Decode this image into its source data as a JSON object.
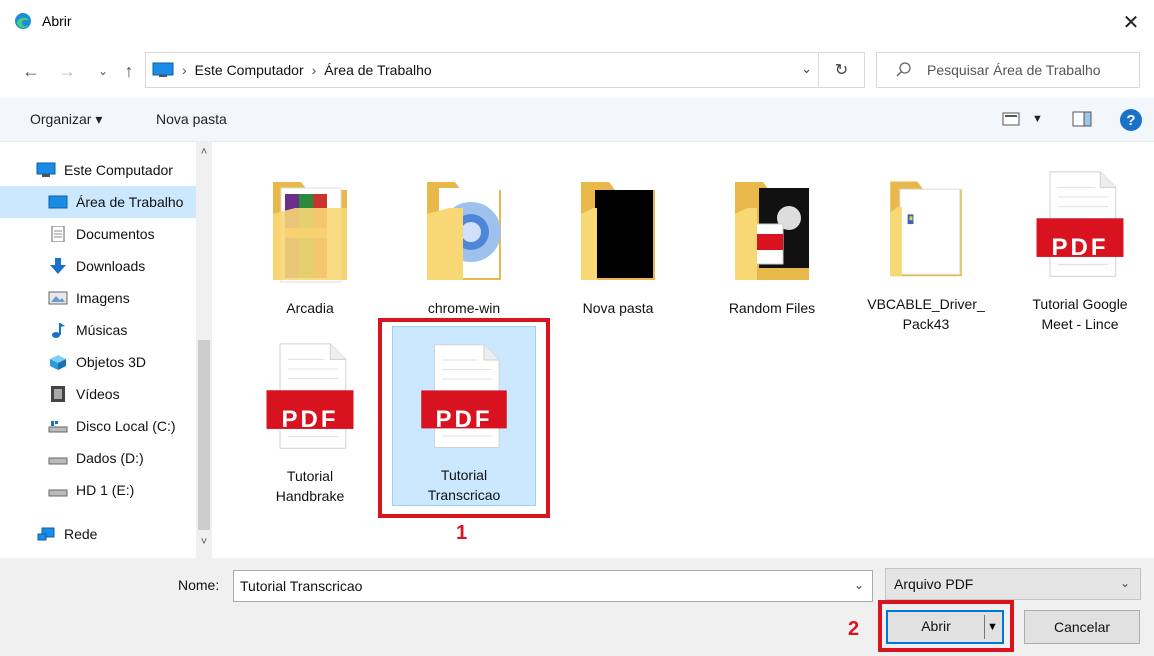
{
  "window": {
    "title": "Abrir",
    "close_glyph": "✕"
  },
  "nav": {
    "back_glyph": "←",
    "forward_glyph": "→",
    "recent_glyph": "⌄",
    "up_glyph": "↑",
    "breadcrumb": [
      "Este Computador",
      "Área de Trabalho"
    ],
    "breadcrumb_sep": "›",
    "dropdown_glyph": "⌄",
    "refresh_glyph": "↻",
    "search_placeholder": "Pesquisar Área de Trabalho"
  },
  "toolbar": {
    "organize_label": "Organizar ▾",
    "new_folder_label": "Nova pasta",
    "help_glyph": "?"
  },
  "sidebar": {
    "items": [
      {
        "label": "Este Computador",
        "icon": "computer-icon"
      },
      {
        "label": "Área de Trabalho",
        "icon": "desktop-icon",
        "selected": true
      },
      {
        "label": "Documentos",
        "icon": "documents-icon"
      },
      {
        "label": "Downloads",
        "icon": "downloads-icon"
      },
      {
        "label": "Imagens",
        "icon": "pictures-icon"
      },
      {
        "label": "Músicas",
        "icon": "music-icon"
      },
      {
        "label": "Objetos 3D",
        "icon": "objects-3d-icon"
      },
      {
        "label": "Vídeos",
        "icon": "videos-icon"
      },
      {
        "label": "Disco Local (C:)",
        "icon": "drive-c-icon"
      },
      {
        "label": "Dados (D:)",
        "icon": "drive-icon"
      },
      {
        "label": "HD 1 (E:)",
        "icon": "drive-icon"
      },
      {
        "label": "Rede",
        "icon": "network-icon"
      }
    ],
    "scroll_up_glyph": "˄",
    "scroll_down_glyph": "˅"
  },
  "files": [
    {
      "label": "Arcadia",
      "type": "folder"
    },
    {
      "label": "chrome-win",
      "type": "folder"
    },
    {
      "label": "Nova pasta",
      "type": "folder"
    },
    {
      "label": "Random Files",
      "type": "folder"
    },
    {
      "label": "VBCABLE_Driver_\nPack43",
      "type": "folder"
    },
    {
      "label": "Tutorial Google\nMeet - Lince",
      "type": "pdf"
    },
    {
      "label": "Tutorial\nHandbrake",
      "type": "pdf"
    },
    {
      "label": "Tutorial\nTranscricao",
      "type": "pdf",
      "selected": true
    }
  ],
  "pdf_badge": "PDF",
  "annotations": {
    "step1": "1",
    "step2": "2"
  },
  "footer": {
    "name_label": "Nome:",
    "name_value": "Tutorial Transcricao",
    "name_dropdown_glyph": "⌄",
    "filetype_value": "Arquivo PDF",
    "filetype_dropdown_glyph": "⌄",
    "open_label": "Abrir",
    "open_split_glyph": "▼",
    "cancel_label": "Cancelar"
  },
  "colors": {
    "accent": "#0078d7",
    "selection": "#cce8ff",
    "annotation_red": "#d9141f",
    "pdf_red": "#d8121e",
    "folder_yellow": "#f8d775"
  }
}
